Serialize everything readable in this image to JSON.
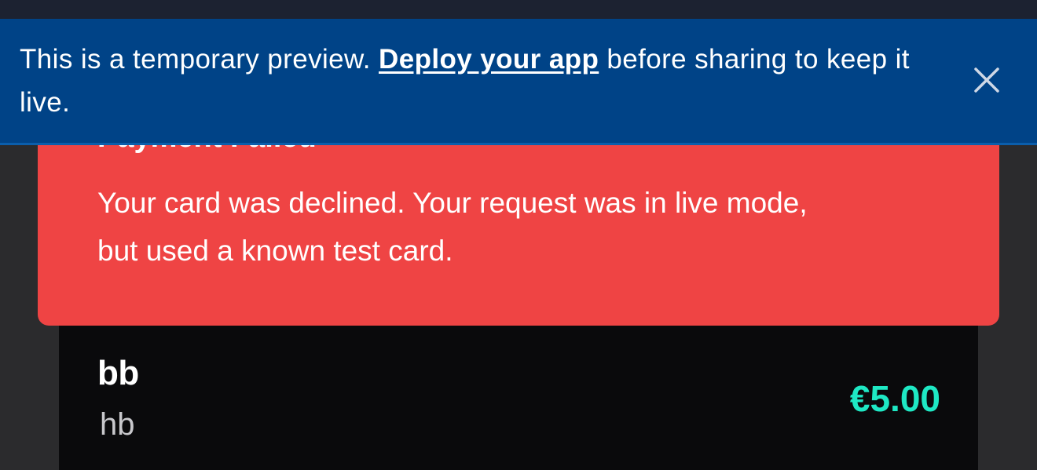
{
  "banner": {
    "text_before": "This is a temporary preview. ",
    "link_label": "Deploy your app",
    "text_after": " before sharing to keep it live.",
    "close_icon": "close-icon"
  },
  "toast": {
    "title": "Payment Failed",
    "message": "Your card was declined. Your request was in live mode, but used a known test card."
  },
  "item": {
    "title": "bb",
    "subtitle": "hb",
    "price": "€5.00"
  },
  "colors": {
    "banner_bg": "#004387",
    "toast_bg": "#ef4444",
    "price_accent": "#1ee8c4",
    "card_bg": "#0a0a0c"
  }
}
